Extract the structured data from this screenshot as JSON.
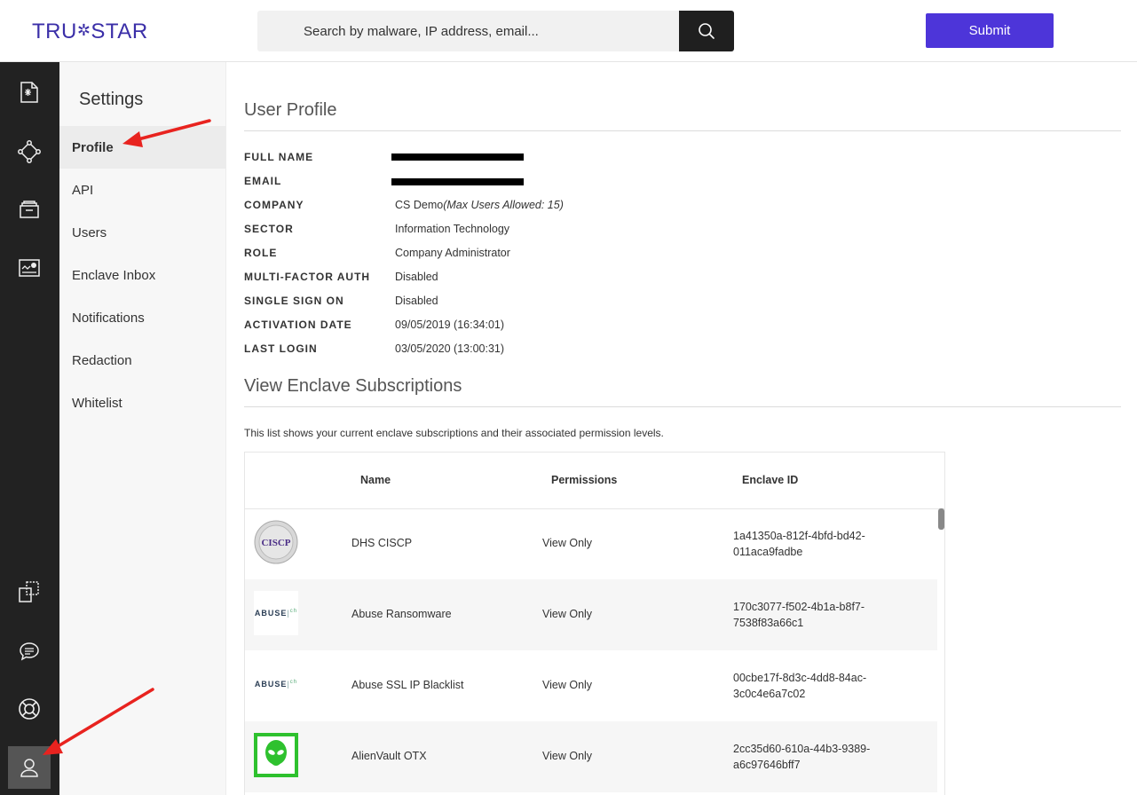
{
  "brand": {
    "logo_text_left": "TRU",
    "logo_text_right": "STAR"
  },
  "header": {
    "search_placeholder": "Search by malware, IP address, email...",
    "submit_label": "Submit"
  },
  "rail": {
    "icons": [
      "reports-icon",
      "graph-icon",
      "archive-icon",
      "dashboard-icon",
      "integrations-icon",
      "chat-icon",
      "help-icon",
      "user-icon"
    ]
  },
  "settings": {
    "title": "Settings",
    "items": [
      {
        "label": "Profile",
        "active": true
      },
      {
        "label": "API",
        "active": false
      },
      {
        "label": "Users",
        "active": false
      },
      {
        "label": "Enclave Inbox",
        "active": false
      },
      {
        "label": "Notifications",
        "active": false
      },
      {
        "label": "Redaction",
        "active": false
      },
      {
        "label": "Whitelist",
        "active": false
      }
    ]
  },
  "profile": {
    "title": "User Profile",
    "fields": [
      {
        "label": "FULL NAME",
        "value": ""
      },
      {
        "label": "EMAIL",
        "value": ""
      },
      {
        "label": "COMPANY",
        "value": "CS Demo",
        "note": "(Max Users Allowed: 15)"
      },
      {
        "label": "SECTOR",
        "value": "Information Technology"
      },
      {
        "label": "ROLE",
        "value": "Company Administrator"
      },
      {
        "label": "MULTI-FACTOR AUTH",
        "value": "Disabled"
      },
      {
        "label": "SINGLE SIGN ON",
        "value": "Disabled"
      },
      {
        "label": "ACTIVATION DATE",
        "value": "09/05/2019 (16:34:01)"
      },
      {
        "label": "LAST LOGIN",
        "value": "03/05/2020 (13:00:31)"
      }
    ]
  },
  "enclaves": {
    "title": "View Enclave Subscriptions",
    "intro": "This list shows your current enclave subscriptions and their associated permission levels.",
    "columns": {
      "name": "Name",
      "permissions": "Permissions",
      "id": "Enclave ID"
    },
    "logo_texts": {
      "ciscp": "CISCP",
      "abuse": "ABUSE",
      "abuse_suffix": "ch"
    },
    "rows": [
      {
        "logo": "ciscp-logo",
        "name": "DHS CISCP",
        "permissions": "View Only",
        "id_line1": "1a41350a-812f-4bfd-bd42-",
        "id_line2": "011aca9fadbe"
      },
      {
        "logo": "abuse-logo",
        "name": "Abuse Ransomware",
        "permissions": "View Only",
        "id_line1": "170c3077-f502-4b1a-b8f7-",
        "id_line2": "7538f83a66c1"
      },
      {
        "logo": "abuse-logo",
        "name": "Abuse SSL IP Blacklist",
        "permissions": "View Only",
        "id_line1": "00cbe17f-8d3c-4dd8-84ac-",
        "id_line2": "3c0c4e6a7c02"
      },
      {
        "logo": "alienvault-logo",
        "name": "AlienVault OTX",
        "permissions": "View Only",
        "id_line1": "2cc35d60-610a-44b3-9389-",
        "id_line2": "a6c97646bff7"
      }
    ]
  },
  "colors": {
    "accent": "#4d35d9",
    "rail": "#222222",
    "arrow": "#e8231f",
    "alienvault": "#2ec12e"
  }
}
